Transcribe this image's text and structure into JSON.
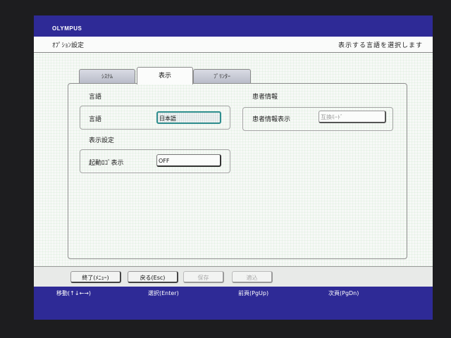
{
  "header": {
    "brand": "OLYMPUS",
    "screen_title": "ｵﾌﾟｼｮﾝ設定",
    "instruction": "表示する言語を選択します"
  },
  "tabs": [
    {
      "label": "ｼｽﾃﾑ",
      "active": false
    },
    {
      "label": "表示",
      "active": true
    },
    {
      "label": "ﾌﾟﾘﾝﾀｰ",
      "active": false
    }
  ],
  "panel": {
    "language_section": {
      "heading": "言語",
      "field_label": "言語",
      "field_value": "日本語"
    },
    "display_section": {
      "heading": "表示設定",
      "field_label": "起動ﾛｺﾞ表示",
      "field_value": "OFF"
    },
    "patient_section": {
      "heading": "患者情報",
      "field_label": "患者情報表示",
      "field_value": "互換ﾓｰﾄﾞ"
    }
  },
  "buttons": {
    "exit": "終了(ﾒﾆｭｰ)",
    "back": "戻る(Esc)",
    "save": "保存",
    "apply": "適込"
  },
  "key_hints": {
    "move": "移動(↑↓←→)",
    "select": "選択(Enter)",
    "prev_page": "前頁(PgUp)",
    "next_page": "次頁(PgDn)"
  }
}
